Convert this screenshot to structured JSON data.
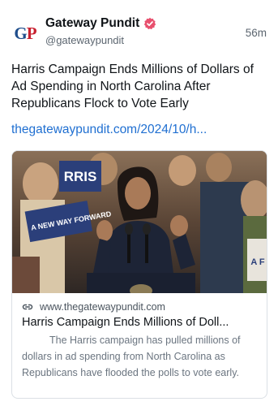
{
  "author": {
    "display_name": "Gateway Pundit",
    "handle": "@gatewaypundit",
    "avatar_text": "GP"
  },
  "post": {
    "time": "56m",
    "text": "Harris Campaign Ends Millions of Dollars of Ad Spending in North Carolina After Republicans Flock to Vote Early",
    "link_text": "thegatewaypundit.com/2024/10/h..."
  },
  "card": {
    "domain": "www.thegatewaypundit.com",
    "title": "Harris Campaign Ends Millions of Doll...",
    "description": "The Harris campaign has pulled millions of dollars in ad spending from North Carolina as Republicans have flooded the polls to vote early.",
    "image_signs": [
      "RRIS",
      "A NEW WAY FORWARD",
      "A F"
    ]
  },
  "colors": {
    "link": "#1f6fd1",
    "verified_badge": "#e8506e",
    "avatar_blue": "#1f4e8c",
    "avatar_red": "#c8202f"
  },
  "icons": {
    "verified": "verified-badge-icon",
    "link": "link-icon"
  }
}
